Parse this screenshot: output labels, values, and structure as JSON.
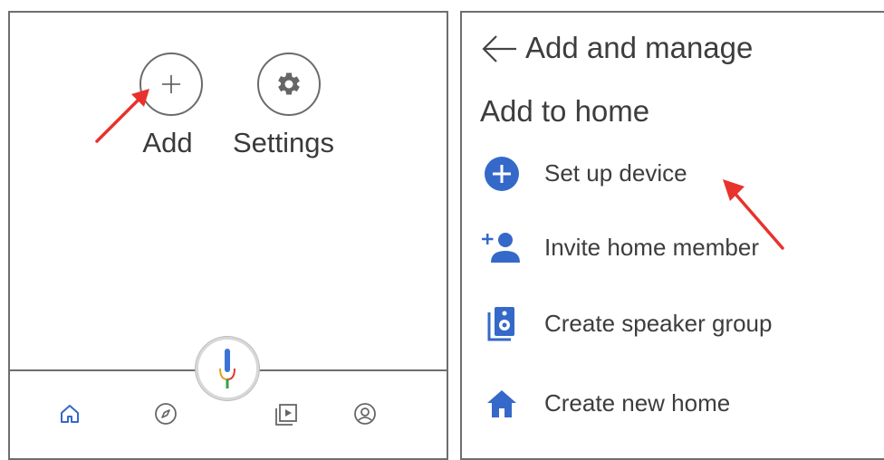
{
  "home_screen": {
    "actions": {
      "add_label": "Add",
      "settings_label": "Settings"
    },
    "bottom_nav": {
      "items": [
        "home-icon",
        "explore-icon",
        "media-icon",
        "account-icon"
      ],
      "assistant": "mic-icon"
    }
  },
  "add_manage_screen": {
    "title": "Add and manage",
    "section_title": "Add to home",
    "items": [
      {
        "label": "Set up device",
        "icon": "add-circle-icon"
      },
      {
        "label": "Invite home member",
        "icon": "add-person-icon"
      },
      {
        "label": "Create speaker group",
        "icon": "speaker-group-icon"
      },
      {
        "label": "Create new home",
        "icon": "home-icon"
      }
    ]
  },
  "colors": {
    "accent_blue": "#3569c9",
    "annotation_red": "#e8322d",
    "border_gray": "#6e6e6e",
    "text_gray": "#3c3c3c"
  }
}
